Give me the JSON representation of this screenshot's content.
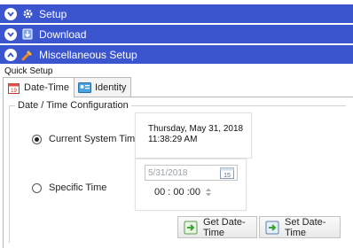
{
  "accordion": [
    {
      "label": "Setup",
      "icon": "gear-icon",
      "state": "collapsed"
    },
    {
      "label": "Download",
      "icon": "download-icon",
      "state": "collapsed"
    },
    {
      "label": "Miscellaneous Setup",
      "icon": "tools-icon",
      "state": "expanded"
    }
  ],
  "quick_setup": {
    "label": "Quick Setup",
    "tabs": [
      {
        "label": "Date-Time",
        "icon": "calendar-icon",
        "active": true
      },
      {
        "label": "Identity",
        "icon": "identity-card-icon",
        "active": false
      }
    ]
  },
  "datetime": {
    "group_title": "Date / Time Configuration",
    "current_label": "Current System Time",
    "current_date": "Thursday, May 31, 2018",
    "current_time": "11:38:29 AM",
    "specific_label": "Specific Time",
    "date_value": "5/31/2018",
    "calendar_day": "15",
    "time_value": "00 : 00 :00",
    "selected_option": "Current System Time"
  },
  "buttons": {
    "get": "Get Date-Time",
    "set": "Set Date-Time"
  },
  "colors": {
    "accordion_header": "#3b55cf",
    "accent_orange": "#f08a1c",
    "accent_green": "#3aa536"
  }
}
